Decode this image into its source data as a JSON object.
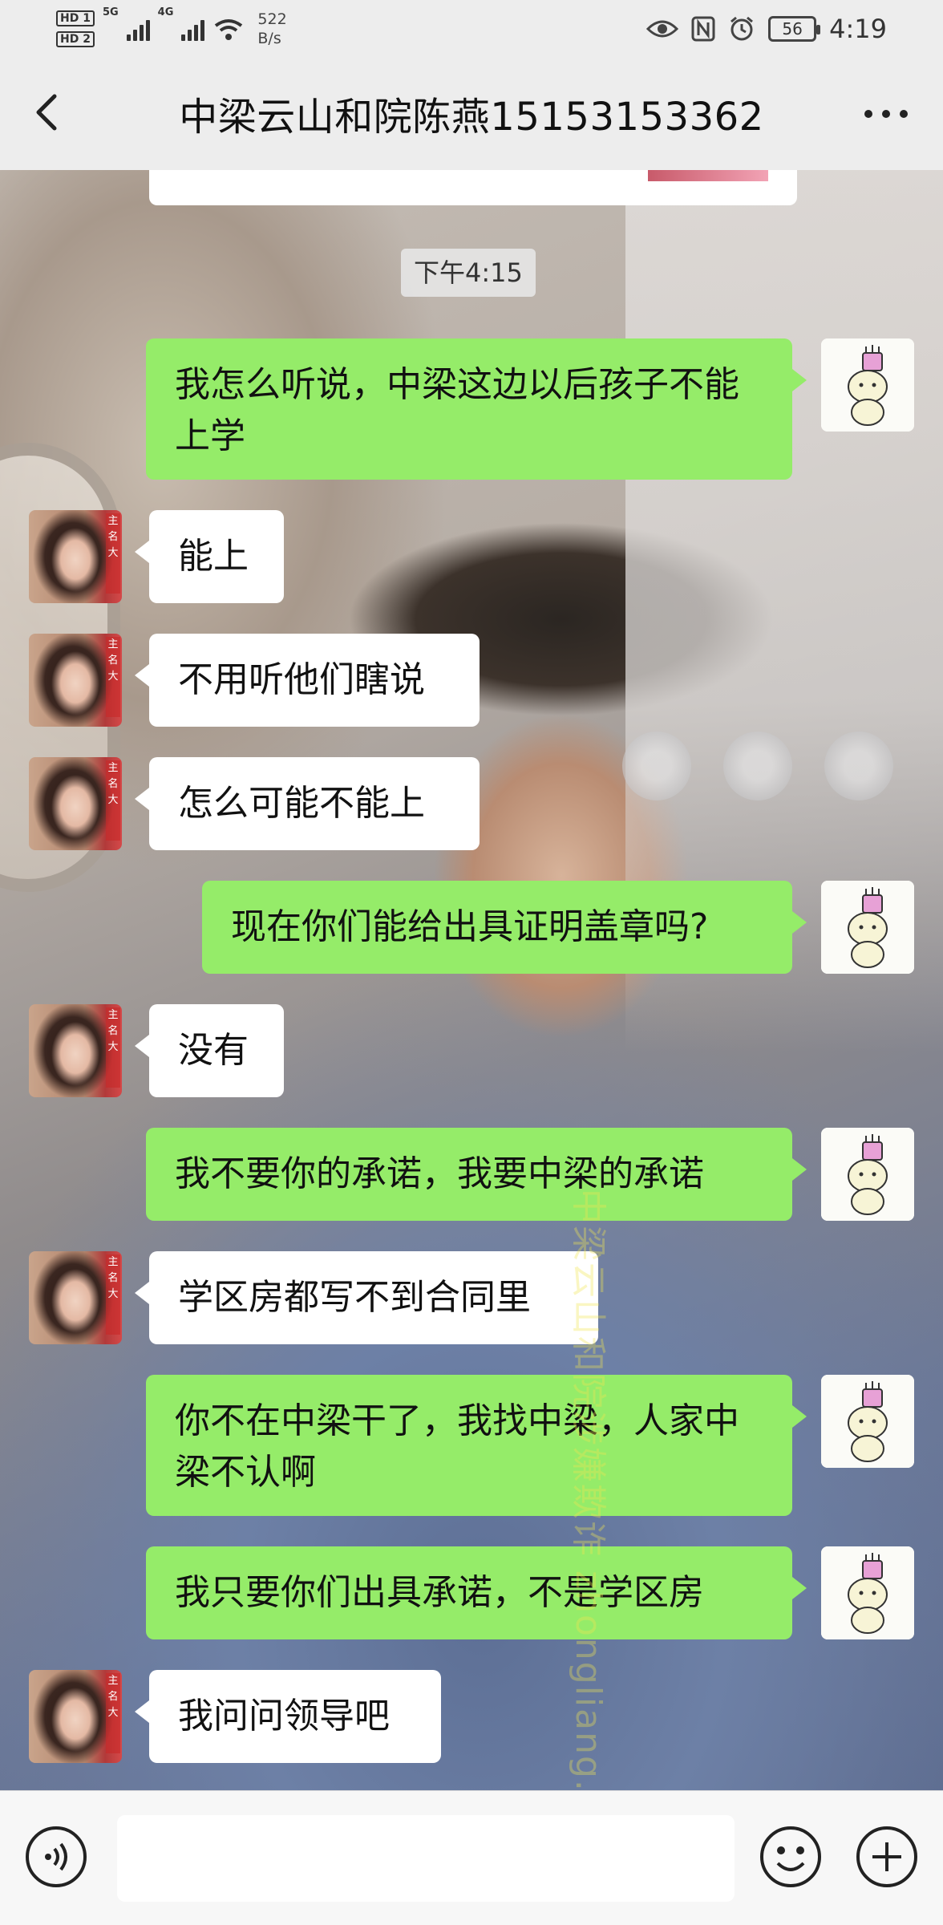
{
  "status_bar": {
    "hd1": "HD 1",
    "hd2": "HD 2",
    "net1": "5G",
    "net2": "4G",
    "speed_value": "522",
    "speed_unit": "B/s",
    "battery": "56",
    "time": "4:19",
    "icons": [
      "eye-icon",
      "nfc-icon",
      "alarm-icon"
    ]
  },
  "header": {
    "title": "中梁云山和院陈燕15153153362",
    "back_icon": "chevron-left-icon",
    "more_icon": "more-dots-icon"
  },
  "timestamp": "下午4:15",
  "messages": [
    {
      "side": "out",
      "text": "我怎么听说，中梁这边以后孩子不能上学"
    },
    {
      "side": "in",
      "text": "能上"
    },
    {
      "side": "in",
      "text": "不用听他们瞎说"
    },
    {
      "side": "in",
      "text": "怎么可能不能上"
    },
    {
      "side": "out",
      "text": "现在你们能给出具证明盖章吗?"
    },
    {
      "side": "in",
      "text": "没有"
    },
    {
      "side": "out",
      "text": "我不要你的承诺，我要中梁的承诺"
    },
    {
      "side": "in",
      "text": "学区房都写不到合同里"
    },
    {
      "side": "out",
      "text": "你不在中梁干了，我找中梁，人家中梁不认啊"
    },
    {
      "side": "out",
      "text": "我只要你们出具承诺，不是学区房"
    },
    {
      "side": "in",
      "text": "我问问领导吧"
    }
  ],
  "watermark": "中梁云山和院涉嫌欺诈 zhongliang.com",
  "avatar_badge": "主名大",
  "input_bar": {
    "voice_icon": "voice-icon",
    "emoji_icon": "emoji-icon",
    "plus_icon": "plus-circle-icon",
    "placeholder": ""
  },
  "colors": {
    "outgoing_bubble": "#95ec69",
    "incoming_bubble": "#ffffff",
    "bar_background": "#ededed"
  }
}
